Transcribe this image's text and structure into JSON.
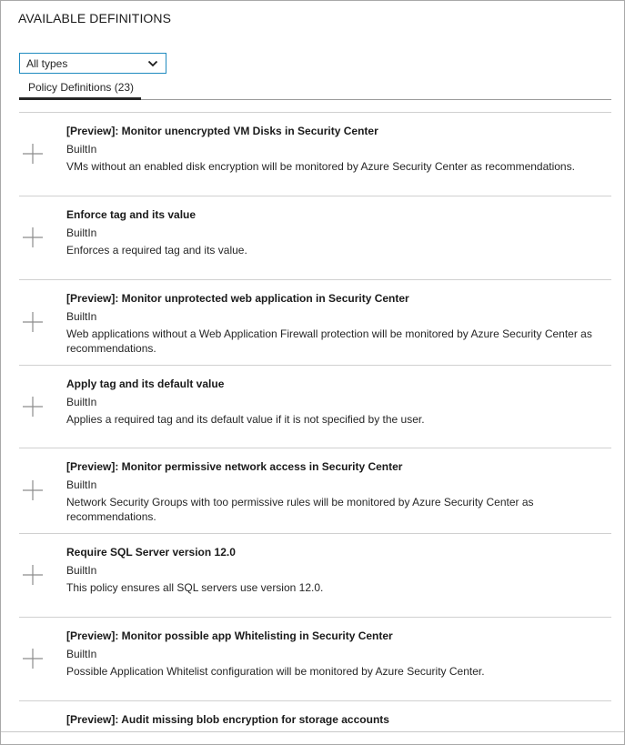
{
  "heading": "AVAILABLE DEFINITIONS",
  "filter": {
    "selected": "All types",
    "icon": "chevron-down-icon"
  },
  "tab": {
    "label": "Policy Definitions (23)"
  },
  "definitions": [
    {
      "title": "[Preview]: Monitor unencrypted VM Disks in Security Center",
      "source": "BuiltIn",
      "description": "VMs without an enabled disk encryption will be monitored by Azure Security Center as recommendations."
    },
    {
      "title": "Enforce tag and its value",
      "source": "BuiltIn",
      "description": "Enforces a required tag and its value."
    },
    {
      "title": "[Preview]: Monitor unprotected web application in Security Center",
      "source": "BuiltIn",
      "description": "Web applications without a Web Application Firewall protection will be monitored by Azure Security Center as recommendations."
    },
    {
      "title": "Apply tag and its default value",
      "source": "BuiltIn",
      "description": "Applies a required tag and its default value if it is not specified by the user."
    },
    {
      "title": "[Preview]: Monitor permissive network access in Security Center",
      "source": "BuiltIn",
      "description": "Network Security Groups with too permissive rules will be monitored by Azure Security Center as recommendations."
    },
    {
      "title": "Require SQL Server version 12.0",
      "source": "BuiltIn",
      "description": "This policy ensures all SQL servers use version 12.0."
    },
    {
      "title": "[Preview]: Monitor possible app Whitelisting in Security Center",
      "source": "BuiltIn",
      "description": "Possible Application Whitelist configuration will be monitored by Azure Security Center."
    },
    {
      "title": "[Preview]: Audit missing blob encryption for storage accounts",
      "source": "",
      "description": ""
    }
  ],
  "icons": {
    "add": "plus-icon"
  },
  "colors": {
    "select_border": "#1f8bbf",
    "divider": "#d0d0d0",
    "tab_underline": "#262626"
  }
}
